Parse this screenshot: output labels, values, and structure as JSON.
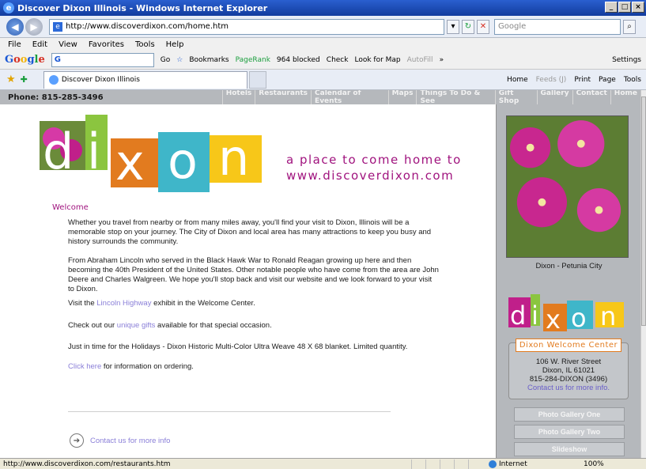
{
  "window": {
    "title": "Discover Dixon Illinois - Windows Internet Explorer",
    "controls": [
      "_",
      "□",
      "×"
    ]
  },
  "address": {
    "url": "http://www.discoverdixon.com/home.htm",
    "search_placeholder": "Google"
  },
  "menu": [
    "File",
    "Edit",
    "View",
    "Favorites",
    "Tools",
    "Help"
  ],
  "google_toolbar": {
    "logo": [
      "G",
      "o",
      "o",
      "g",
      "l",
      "e"
    ],
    "search_value": "G",
    "go_label": "Go",
    "bookmarks": "Bookmarks",
    "pagerank": "PageRank",
    "blocked": "964 blocked",
    "check": "Check",
    "lookup": "Look for Map",
    "autofill": "AutoFill",
    "more": "»",
    "settings": "Settings"
  },
  "tabs": {
    "active_tab": "Discover Dixon Illinois",
    "commands": [
      "Home",
      "Feeds (J)",
      "Print",
      "Page",
      "Tools"
    ]
  },
  "site": {
    "phone": "Phone: 815-285-3496",
    "nav": [
      "Hotels",
      "Restaurants",
      "Calendar of Events",
      "Maps",
      "Things To Do & See",
      "Gift Shop",
      "Gallery",
      "Contact",
      "Home"
    ],
    "logo_letters": [
      "d",
      "i",
      "x",
      "o",
      "n"
    ],
    "tagline_1": "a place to come home to",
    "tagline_2": "www.discoverdixon.com",
    "welcome": "Welcome",
    "p1": "Whether you travel from nearby or from many miles away, you'll find your visit to Dixon, Illinois will be a memorable stop on your journey. The City of Dixon and local area has many attractions to keep you busy and history surrounds the community.",
    "p2": "From Abraham Lincoln who served in the Black Hawk War to Ronald Reagan growing up here and then becoming the 40th President of the United States. Other notable people who have come from the area are John Deere and Charles Walgreen. We hope you'll stop back and visit our website and we look forward to your visit to Dixon.",
    "p3_pre": "Visit the ",
    "p3_link": "Lincoln Highway",
    "p3_post": " exhibit in the Welcome Center.",
    "p4_pre": "Check out our ",
    "p4_link": "unique gifts",
    "p4_post": " available for that special occasion.",
    "p5": "Just in time for the Holidays - Dixon Historic Multi-Color Ultra Weave 48 X 68 blanket. Limited quantity.",
    "p6_link": "Click here",
    "p6_post": " for information on ordering.",
    "contact_link": "Contact us for more info",
    "photo_caption": "Dixon - Petunia City",
    "center_title": "Dixon Welcome Center",
    "center_addr1": "106 W. River Street",
    "center_addr2": "Dixon, IL 61021",
    "center_phone": "815-284-DIXON (3496)",
    "center_link": "Contact us for more info.",
    "side_buttons": [
      "Photo Gallery One",
      "Photo Gallery Two",
      "Slideshow"
    ]
  },
  "status": {
    "url": "http://www.discoverdixon.com/restaurants.htm",
    "zone": "Internet",
    "zoom": "100%"
  },
  "colors": {
    "accent": "#a0137e",
    "logo_d": "#c01f8a",
    "logo_i": "#8bc53f",
    "logo_x": "#e27b1f",
    "logo_o": "#3fb6c9",
    "logo_n": "#f7c719"
  }
}
